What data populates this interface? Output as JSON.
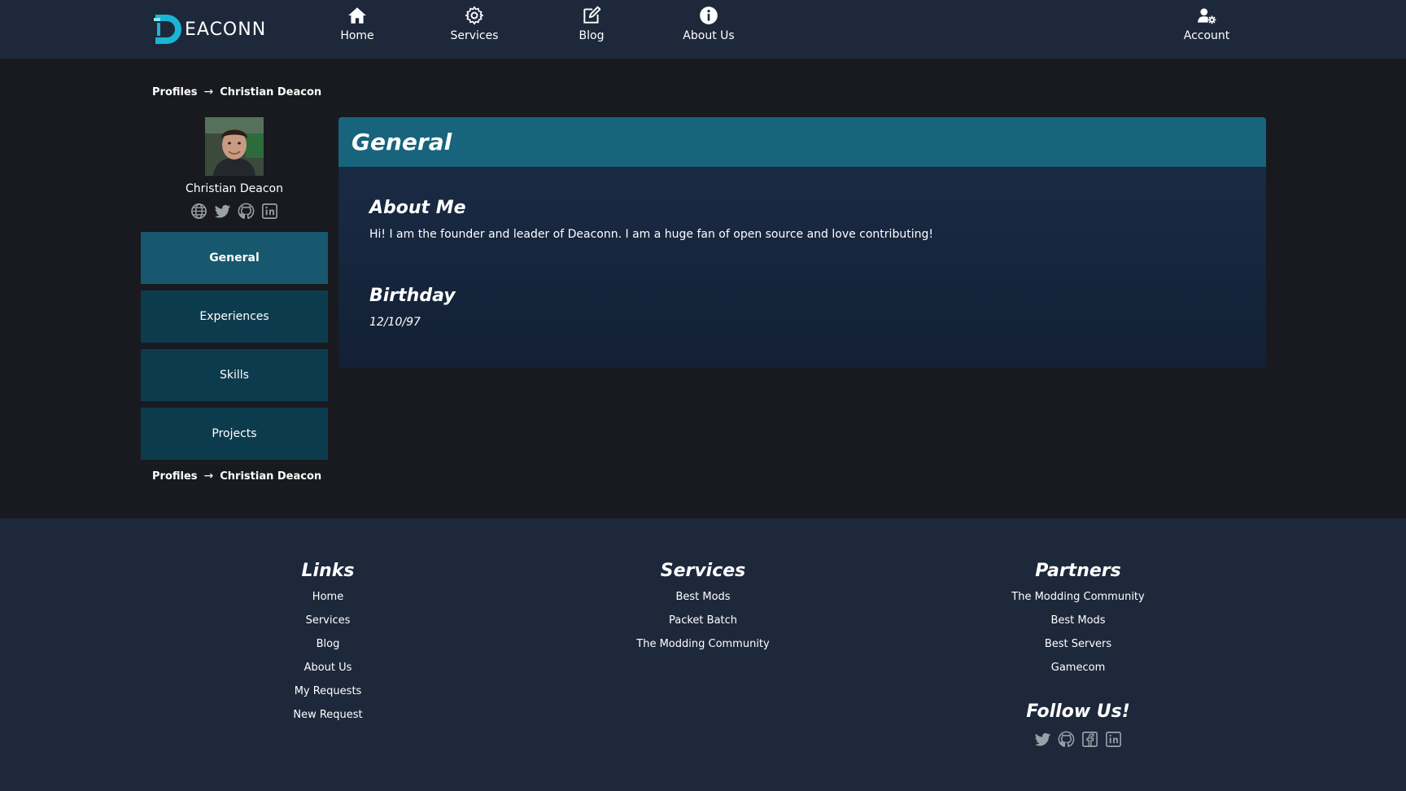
{
  "brand": {
    "logo_text": "EACONN",
    "accent": "#1ab5d6"
  },
  "nav": {
    "items": [
      {
        "label": "Home",
        "icon": "home-icon"
      },
      {
        "label": "Services",
        "icon": "gear-icon"
      },
      {
        "label": "Blog",
        "icon": "edit-icon"
      },
      {
        "label": "About Us",
        "icon": "info-icon"
      }
    ],
    "account": {
      "label": "Account",
      "icon": "user-settings-icon"
    }
  },
  "breadcrumb": {
    "root": "Profiles",
    "arrow": "→",
    "current": "Christian Deacon"
  },
  "profile": {
    "name": "Christian Deacon",
    "socials": [
      "globe-icon",
      "twitter-icon",
      "github-icon",
      "linkedin-icon"
    ]
  },
  "sidebar": {
    "items": [
      {
        "label": "General",
        "active": true
      },
      {
        "label": "Experiences",
        "active": false
      },
      {
        "label": "Skills",
        "active": false
      },
      {
        "label": "Projects",
        "active": false
      }
    ]
  },
  "main": {
    "title": "General",
    "about": {
      "heading": "About Me",
      "text": "Hi! I am the founder and leader of Deaconn. I am a huge fan of open source and love contributing!"
    },
    "birthday": {
      "heading": "Birthday",
      "value": "12/10/97"
    }
  },
  "footer": {
    "links": {
      "title": "Links",
      "items": [
        "Home",
        "Services",
        "Blog",
        "About Us",
        "My Requests",
        "New Request"
      ]
    },
    "services": {
      "title": "Services",
      "items": [
        "Best Mods",
        "Packet Batch",
        "The Modding Community"
      ]
    },
    "partners": {
      "title": "Partners",
      "items": [
        "The Modding Community",
        "Best Mods",
        "Best Servers",
        "Gamecom"
      ]
    },
    "follow": {
      "title": "Follow Us!",
      "socials": [
        "twitter-icon",
        "github-icon",
        "facebook-icon",
        "linkedin-icon"
      ]
    }
  },
  "colors": {
    "nav_bg": "#1e283b",
    "page_bg": "#181a1f",
    "sidebar_btn": "#0d3b4e",
    "sidebar_btn_active": "#17586e",
    "card_header": "#17647c",
    "icon_gray": "#9aa0a8"
  }
}
